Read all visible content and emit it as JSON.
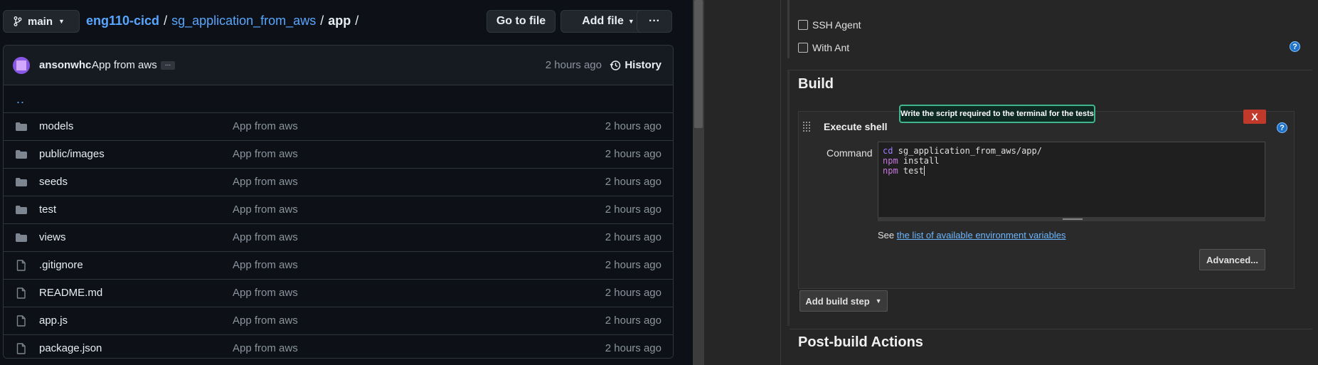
{
  "github": {
    "branch": "main",
    "breadcrumb": {
      "repo": "eng110-cicd",
      "folder": "sg_application_from_aws",
      "current": "app"
    },
    "buttons": {
      "go_to_file": "Go to file",
      "add_file": "Add file",
      "more": "···"
    },
    "commit": {
      "author": "ansonwhc",
      "message": "App from aws",
      "ellipsis": "...",
      "time": "2 hours ago",
      "history_label": "History"
    },
    "parent_link": "..",
    "files": [
      {
        "name": "models",
        "type": "folder",
        "message": "App from aws",
        "time": "2 hours ago"
      },
      {
        "name": "public/images",
        "type": "folder",
        "message": "App from aws",
        "time": "2 hours ago"
      },
      {
        "name": "seeds",
        "type": "folder",
        "message": "App from aws",
        "time": "2 hours ago"
      },
      {
        "name": "test",
        "type": "folder",
        "message": "App from aws",
        "time": "2 hours ago"
      },
      {
        "name": "views",
        "type": "folder",
        "message": "App from aws",
        "time": "2 hours ago"
      },
      {
        "name": ".gitignore",
        "type": "file",
        "message": "App from aws",
        "time": "2 hours ago"
      },
      {
        "name": "README.md",
        "type": "file",
        "message": "App from aws",
        "time": "2 hours ago"
      },
      {
        "name": "app.js",
        "type": "file",
        "message": "App from aws",
        "time": "2 hours ago"
      },
      {
        "name": "package.json",
        "type": "file",
        "message": "App from aws",
        "time": "2 hours ago"
      }
    ]
  },
  "jenkins": {
    "checkboxes": {
      "ssh_agent": "SSH Agent",
      "with_ant": "With Ant"
    },
    "build_title": "Build",
    "step": {
      "title": "Execute shell",
      "delete_label": "X",
      "tooltip": "Write the script required to the terminal for the tests",
      "command_label": "Command",
      "command_lines": [
        {
          "kw": "cd",
          "rest": " sg_application_from_aws/app/"
        },
        {
          "kw": "npm",
          "rest": " install"
        },
        {
          "kw": "npm",
          "rest": " test"
        }
      ],
      "env_prefix": "See ",
      "env_link": "the list of available environment variables",
      "advanced_label": "Advanced..."
    },
    "add_build_step": "Add build step",
    "post_build_title": "Post-build Actions",
    "help_glyph": "?"
  }
}
